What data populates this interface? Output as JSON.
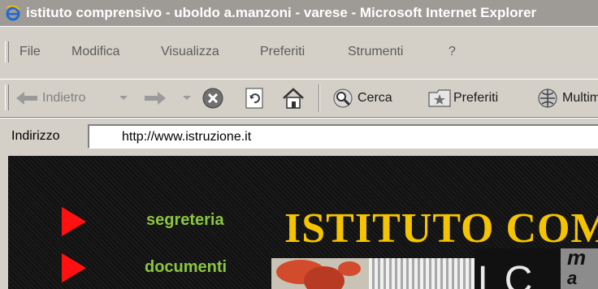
{
  "window": {
    "title": "istituto comprensivo - uboldo a.manzoni - varese - Microsoft Internet Explorer"
  },
  "menu": {
    "items": [
      "File",
      "Modifica",
      "Visualizza",
      "Preferiti",
      "Strumenti",
      "?"
    ]
  },
  "toolbar": {
    "back_label": "Indietro",
    "search_label": "Cerca",
    "favorites_label": "Preferiti",
    "media_label": "Multimedia"
  },
  "address": {
    "label": "Indirizzo",
    "url": "http://www.istruzione.it"
  },
  "page": {
    "nav": [
      "segreteria",
      "documenti"
    ],
    "banner_title": "ISTITUTO COMPRENSIVO",
    "logo_letters": "LC",
    "logo_m": "m",
    "logo_a": "a"
  },
  "colors": {
    "titlebar": "#9e9a95",
    "chrome": "#d4d0c8",
    "arrow": "#ff1111",
    "nav_link": "#8cc63f",
    "banner_title": "#f5c400"
  },
  "icons": {
    "ie": "ie-logo-icon",
    "back": "back-arrow-icon",
    "forward": "forward-arrow-icon",
    "stop": "stop-icon",
    "refresh": "refresh-icon",
    "home": "home-icon",
    "search": "search-icon",
    "favorites": "favorites-icon",
    "media": "media-icon"
  }
}
